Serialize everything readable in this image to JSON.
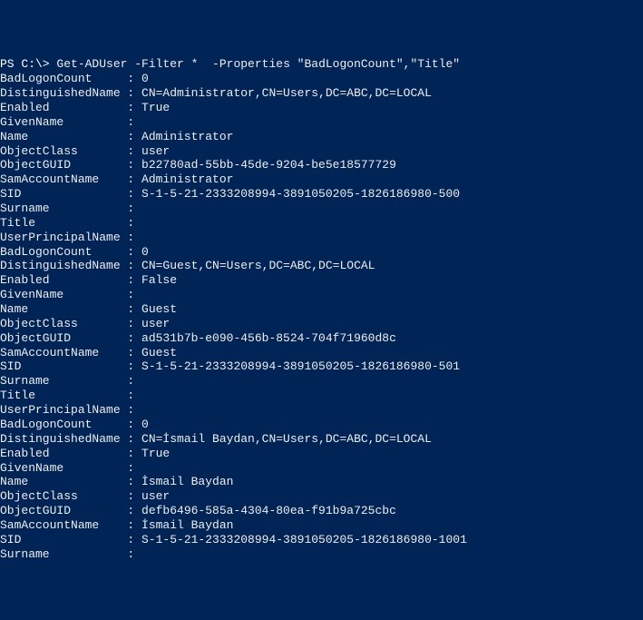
{
  "prompt": "PS C:\\> ",
  "command": "Get-ADUser -Filter *  -Properties \"BadLogonCount\",\"Title\"",
  "label_width": 17,
  "records": [
    {
      "fields": [
        {
          "key": "BadLogonCount",
          "value": "0"
        },
        {
          "key": "DistinguishedName",
          "value": "CN=Administrator,CN=Users,DC=ABC,DC=LOCAL"
        },
        {
          "key": "Enabled",
          "value": "True"
        },
        {
          "key": "GivenName",
          "value": ""
        },
        {
          "key": "Name",
          "value": "Administrator"
        },
        {
          "key": "ObjectClass",
          "value": "user"
        },
        {
          "key": "ObjectGUID",
          "value": "b22780ad-55bb-45de-9204-be5e18577729"
        },
        {
          "key": "SamAccountName",
          "value": "Administrator"
        },
        {
          "key": "SID",
          "value": "S-1-5-21-2333208994-3891050205-1826186980-500"
        },
        {
          "key": "Surname",
          "value": ""
        },
        {
          "key": "Title",
          "value": ""
        },
        {
          "key": "UserPrincipalName",
          "value": ""
        }
      ]
    },
    {
      "fields": [
        {
          "key": "BadLogonCount",
          "value": "0"
        },
        {
          "key": "DistinguishedName",
          "value": "CN=Guest,CN=Users,DC=ABC,DC=LOCAL"
        },
        {
          "key": "Enabled",
          "value": "False"
        },
        {
          "key": "GivenName",
          "value": ""
        },
        {
          "key": "Name",
          "value": "Guest"
        },
        {
          "key": "ObjectClass",
          "value": "user"
        },
        {
          "key": "ObjectGUID",
          "value": "ad531b7b-e090-456b-8524-704f71960d8c"
        },
        {
          "key": "SamAccountName",
          "value": "Guest"
        },
        {
          "key": "SID",
          "value": "S-1-5-21-2333208994-3891050205-1826186980-501"
        },
        {
          "key": "Surname",
          "value": ""
        },
        {
          "key": "Title",
          "value": ""
        },
        {
          "key": "UserPrincipalName",
          "value": ""
        }
      ]
    },
    {
      "fields": [
        {
          "key": "BadLogonCount",
          "value": "0"
        },
        {
          "key": "DistinguishedName",
          "value": "CN=İsmail Baydan,CN=Users,DC=ABC,DC=LOCAL"
        },
        {
          "key": "Enabled",
          "value": "True"
        },
        {
          "key": "GivenName",
          "value": ""
        },
        {
          "key": "Name",
          "value": "İsmail Baydan"
        },
        {
          "key": "ObjectClass",
          "value": "user"
        },
        {
          "key": "ObjectGUID",
          "value": "defb6496-585a-4304-80ea-f91b9a725cbc"
        },
        {
          "key": "SamAccountName",
          "value": "İsmail Baydan"
        },
        {
          "key": "SID",
          "value": "S-1-5-21-2333208994-3891050205-1826186980-1001"
        },
        {
          "key": "Surname",
          "value": ""
        }
      ]
    }
  ]
}
